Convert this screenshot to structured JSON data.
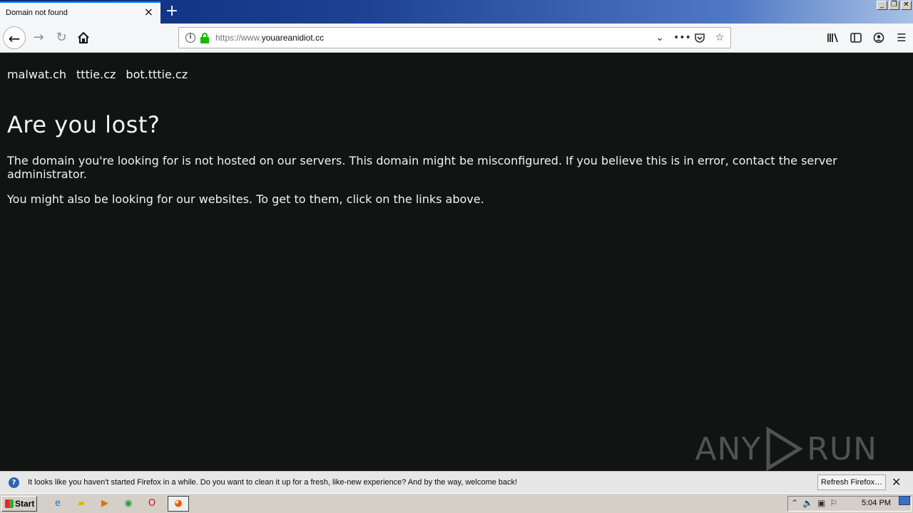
{
  "browser": {
    "tab_title": "Domain not found",
    "tab_close_icon": "×",
    "new_tab_icon": "+",
    "window_buttons": [
      "_",
      "❐",
      "✕"
    ],
    "url_protocol": "https://www.",
    "url_host": "youareanidiot.cc"
  },
  "page": {
    "links": [
      "malwat.ch",
      "tttie.cz",
      "bot.tttie.cz"
    ],
    "heading": "Are you lost?",
    "paragraph1": "The domain you're looking for is not hosted on our servers. This domain might be misconfigured. If you believe this is in error, contact the server administrator.",
    "paragraph2": "You might also be looking for our websites. To get to them, click on the links above.",
    "watermark_left": "ANY",
    "watermark_right": "RUN"
  },
  "notification": {
    "text": "It looks like you haven't started Firefox in a while. Do you want to clean it up for a fresh, like-new experience? And by the way, welcome back!",
    "button_label": "Refresh Firefox…"
  },
  "taskbar": {
    "start_label": "Start",
    "clock": "5:04 PM"
  }
}
